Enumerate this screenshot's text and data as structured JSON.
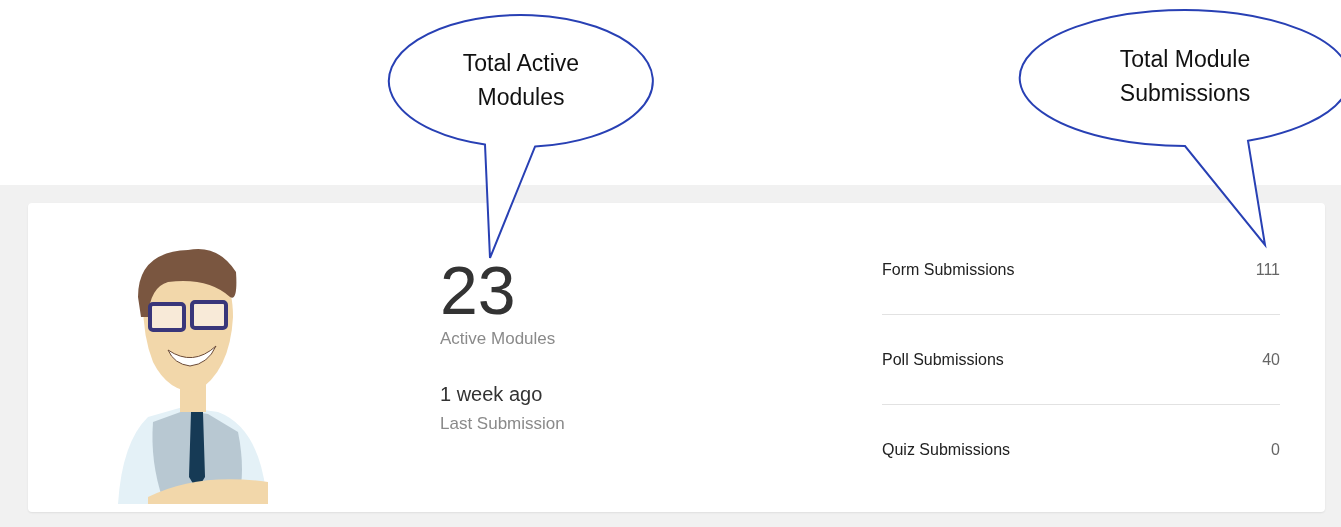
{
  "callouts": [
    {
      "text": "Total Active Modules"
    },
    {
      "text": "Total Module Submissions"
    }
  ],
  "summary": {
    "active_modules": {
      "value": "23",
      "label": "Active Modules"
    },
    "last_submission": {
      "value": "1 week ago",
      "label": "Last Submission"
    }
  },
  "submissions": [
    {
      "label": "Form Submissions",
      "count": "111"
    },
    {
      "label": "Poll Submissions",
      "count": "40"
    },
    {
      "label": "Quiz Submissions",
      "count": "0"
    }
  ]
}
